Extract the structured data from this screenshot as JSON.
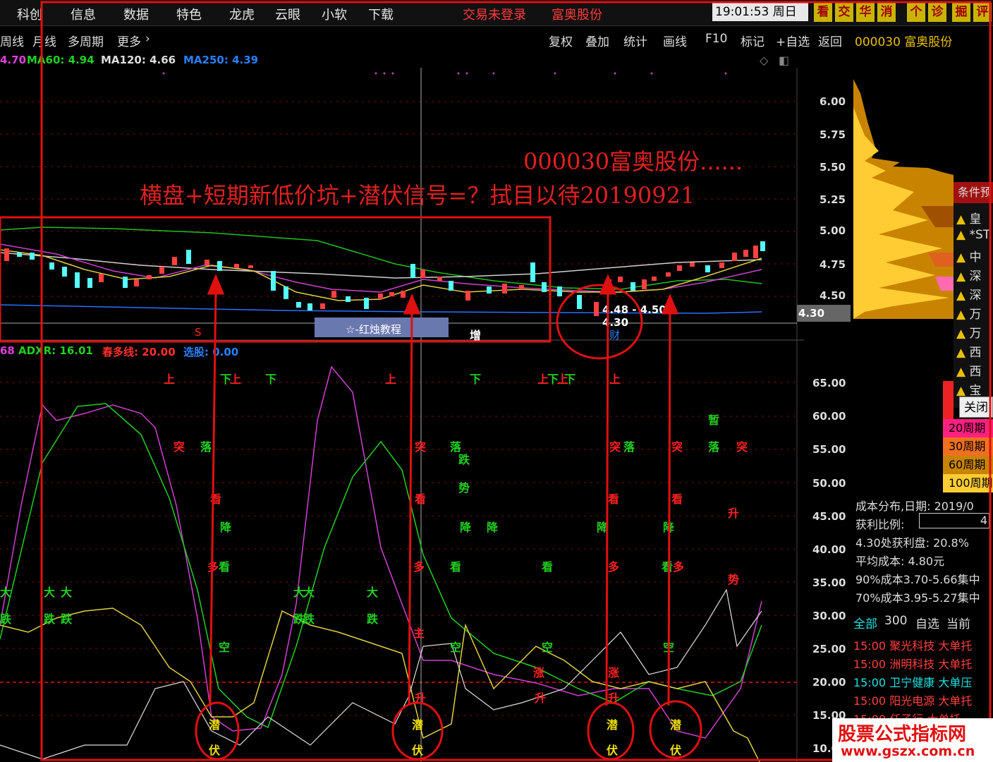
{
  "menubar": {
    "items": [
      "科创",
      "信息",
      "数据",
      "特色",
      "龙虎",
      "云眼",
      "小软",
      "下载"
    ],
    "status_login": "交易未登录",
    "status_stock": "富奥股份",
    "clock": "19:01:53 周日",
    "quick_buttons": [
      "看",
      "交",
      "华",
      "消",
      "个",
      "诊",
      "掘",
      "评"
    ]
  },
  "toolbar": {
    "left": [
      "周线",
      "月线",
      "多周期",
      "更多"
    ],
    "right": [
      "复权",
      "叠加",
      "统计",
      "画线",
      "F10",
      "标记",
      "+自选",
      "返回"
    ],
    "stock_code_name": "000030 富奥股份"
  },
  "ma_legend": {
    "ma_partial": "4.70",
    "ma60": "MA60: 4.94",
    "ma120": "MA120: 4.66",
    "ma250": "MA250: 4.39"
  },
  "price_axis": [
    "6.00",
    "5.75",
    "5.50",
    "5.25",
    "5.00",
    "4.75",
    "4.50"
  ],
  "current_price_tag": "4.30",
  "annotations": {
    "title": "000030富奥股份......",
    "subtitle": "横盘+短期新低价坑+潜伏信号=？拭目以待20190921",
    "range_label": "4.48 - 4.50",
    "low_label": "4.30",
    "cai_label": "财",
    "zeng_label": "增",
    "hongzhu_label": "☆-红烛教程",
    "san_label": "S"
  },
  "indicator_legend": {
    "partial": "68",
    "adxr": "ADXR: 16.01",
    "chunduo": "春多线: 20.00",
    "xuangu": "选股: 0.00"
  },
  "indicator_axis": [
    "65.00",
    "60.00",
    "55.00",
    "50.00",
    "45.00",
    "40.00",
    "35.00",
    "30.00",
    "25.00",
    "20.00",
    "15.00",
    "10.0"
  ],
  "signals": {
    "shang": "上",
    "xia": "下",
    "tu": "突",
    "luo": "落",
    "kan": "看",
    "jiang": "降",
    "da": "大",
    "die": "跌",
    "kong": "空",
    "zan": "暂",
    "sheng": "升",
    "shi": "势",
    "duo": "多",
    "zhu": "主",
    "qian": "潜",
    "fu": "伏",
    "zhang": "涨"
  },
  "condition_panel": {
    "title": "条件预",
    "items": [
      "皇",
      "*ST",
      "中",
      "深",
      "深",
      "万",
      "万",
      "西",
      "西",
      "宝"
    ],
    "close": "关闭"
  },
  "cost_legend": [
    "20周期",
    "30周期",
    "60周期",
    "100周期"
  ],
  "cost_info": {
    "date": "成本分布,日期: 2019/0",
    "ratio_label": "获利比例:",
    "ratio_value": "4",
    "profit": "4.30处获利盘: 20.8%",
    "avg_cost": "平均成本: 4.80元",
    "c90": "90%成本3.70-5.66集中",
    "c70": "70%成本3.95-5.27集中"
  },
  "stock_list": {
    "tabs": [
      "全部",
      "300",
      "自选",
      "当前"
    ],
    "rows": [
      {
        "time": "15:00",
        "name": "聚光科技",
        "type": "大单托",
        "color": "#ff4040"
      },
      {
        "time": "15:00",
        "name": "洲明科技",
        "type": "大单托",
        "color": "#ff4040"
      },
      {
        "time": "15:00",
        "name": "卫宁健康",
        "type": "大单压",
        "color": "#20e0e0"
      },
      {
        "time": "15:00",
        "name": "阳光电源",
        "type": "大单托",
        "color": "#ff4040"
      },
      {
        "time": "15:00",
        "name": "任子行",
        "type": "大单托",
        "color": "#ff4040"
      }
    ]
  },
  "watermark": {
    "line1": "股票公式指标网",
    "line2": "www.gszx.com.cn"
  }
}
